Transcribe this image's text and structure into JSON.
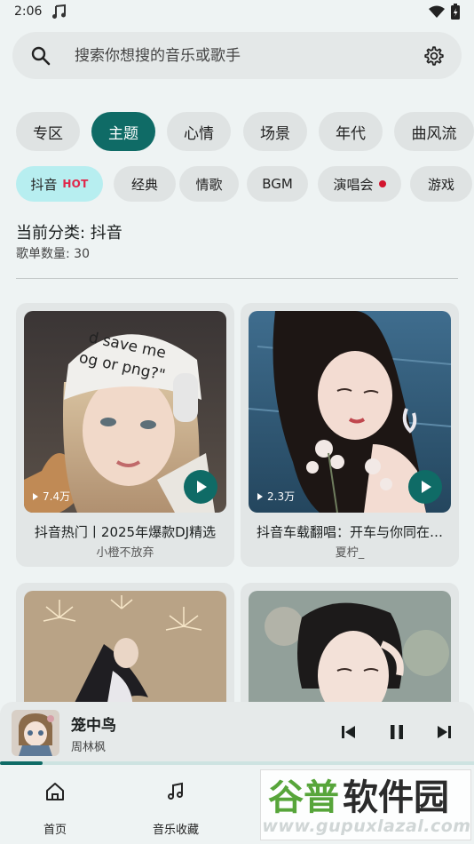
{
  "status_bar": {
    "time": "2:06",
    "music_icon": "music-note-icon",
    "wifi_icon": "wifi-icon",
    "battery_icon": "battery-icon"
  },
  "search": {
    "placeholder": "搜索你想搜的音乐或歌手",
    "search_icon": "search-icon",
    "settings_icon": "gear-icon"
  },
  "categories": [
    {
      "label": "专区",
      "active": false
    },
    {
      "label": "主题",
      "active": true
    },
    {
      "label": "心情",
      "active": false
    },
    {
      "label": "场景",
      "active": false
    },
    {
      "label": "年代",
      "active": false
    },
    {
      "label": "曲风流",
      "active": false
    }
  ],
  "tags": [
    {
      "label": "抖音",
      "badge": "HOT",
      "active": true
    },
    {
      "label": "经典"
    },
    {
      "label": "情歌"
    },
    {
      "label": "BGM"
    },
    {
      "label": "演唱会",
      "dot": true
    },
    {
      "label": "游戏"
    }
  ],
  "info": {
    "current_category": "当前分类: 抖音",
    "playlist_count": "歌单数量: 30"
  },
  "playlists": [
    {
      "title": "抖音热门丨2025年爆款DJ精选",
      "author": "小橙不放弃",
      "plays": "7.4万"
    },
    {
      "title": "抖音车载翻唱：开车与你同在…",
      "author": "夏柠_",
      "plays": "2.3万"
    },
    {
      "title": "",
      "author": "",
      "plays": ""
    },
    {
      "title": "",
      "author": "",
      "plays": ""
    }
  ],
  "player": {
    "song": "笼中鸟",
    "artist": "周林枫",
    "progress": 0.09
  },
  "nav": [
    {
      "label": "首页",
      "icon": "home-icon"
    },
    {
      "label": "音乐收藏",
      "icon": "music-library-icon"
    }
  ],
  "watermark": {
    "logo_text": "谷普软件园",
    "url": "www.gupuxlazal.com"
  },
  "colors": {
    "accent": "#0f6b66",
    "chip_active_tag": "#b7eef0",
    "hot": "#e0264a",
    "background": "#eef3f3"
  }
}
